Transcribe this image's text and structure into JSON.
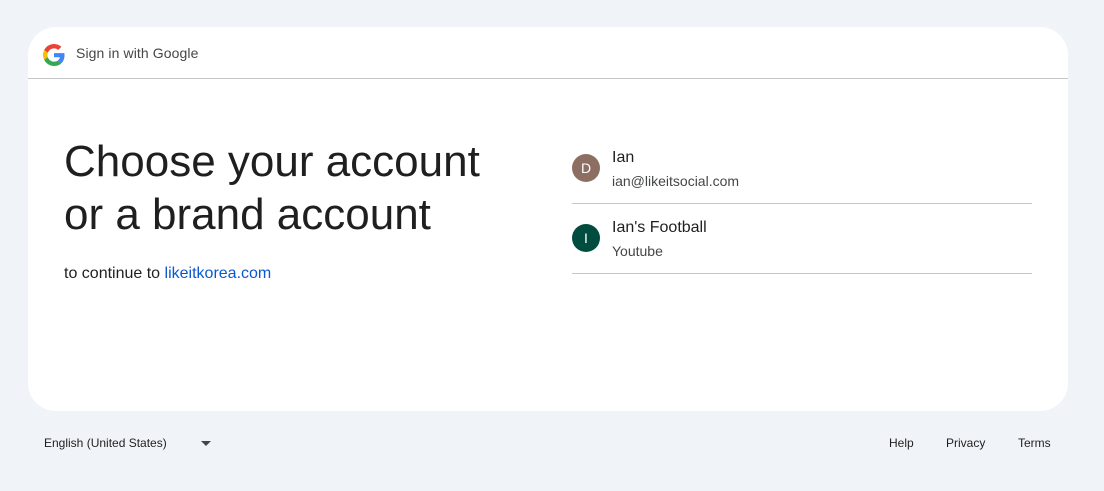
{
  "header": {
    "title": "Sign in with Google"
  },
  "main": {
    "headline_line1": "Choose your account",
    "headline_line2": "or a brand account",
    "continue_prefix": "to continue to",
    "continue_link": "likeitkorea.com"
  },
  "accounts": [
    {
      "initial": "D",
      "name": "Ian",
      "detail": "ian@likeitsocial.com",
      "avatar_color": "#8d6e63"
    },
    {
      "initial": "I",
      "name": "Ian's Football",
      "detail": "Youtube",
      "avatar_color": "#004d40"
    }
  ],
  "footer": {
    "language": "English (United States)",
    "help": "Help",
    "privacy": "Privacy",
    "terms": "Terms"
  },
  "colors": {
    "background": "#f0f4f9",
    "card": "#ffffff",
    "link": "#0b57d0",
    "divider": "#c4c7c5"
  },
  "icons": {
    "logo": "google-g-logo-icon",
    "language_dropdown": "caret-down-icon"
  }
}
